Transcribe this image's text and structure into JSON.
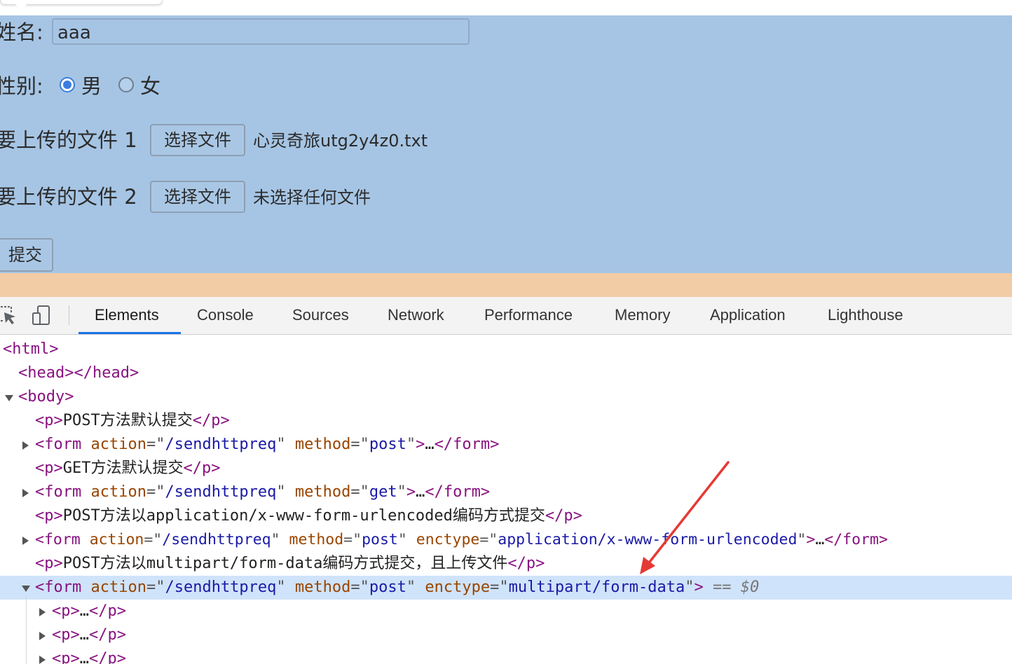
{
  "page": {
    "form": {
      "name_label": "姓名:",
      "name_value": "aaa",
      "gender_label": "性别:",
      "gender_options": [
        {
          "label": "男",
          "checked": true
        },
        {
          "label": "女",
          "checked": false
        }
      ],
      "file1_label": "要上传的文件 1",
      "file1_button": "选择文件",
      "file1_status": "心灵奇旅utg2y4z0.txt",
      "file2_label": "要上传的文件 2",
      "file2_button": "选择文件",
      "file2_status": "未选择任何文件",
      "submit_label": "提交"
    },
    "colors": {
      "content_highlight": "#a6c5e4",
      "margin_highlight": "#f2cca4",
      "selected_row": "#cfe3fa",
      "tab_underline": "#1a73e8",
      "annotation_arrow": "#e53935"
    }
  },
  "devtools": {
    "toolbar_icons": [
      "inspect-element-icon",
      "device-toolbar-icon"
    ],
    "tabs": [
      {
        "label": "Elements",
        "active": true
      },
      {
        "label": "Console",
        "active": false
      },
      {
        "label": "Sources",
        "active": false
      },
      {
        "label": "Network",
        "active": false
      },
      {
        "label": "Performance",
        "active": false
      },
      {
        "label": "Memory",
        "active": false
      },
      {
        "label": "Application",
        "active": false
      },
      {
        "label": "Lighthouse",
        "active": false
      }
    ],
    "dom": {
      "html_tag": "html",
      "head_tag": "head",
      "body_tag": "body",
      "p_tag": "p",
      "form_tag": "form",
      "action_attr": "action",
      "method_attr": "method",
      "enctype_attr": "enctype",
      "action_value": "/sendhttpreq",
      "method_post": "post",
      "method_get": "get",
      "enctype_urlencoded": "application/x-www-form-urlencoded",
      "enctype_multipart": "multipart/form-data",
      "p1_text": "POST方法默认提交",
      "p2_text": "GET方法默认提交",
      "p3_text": "POST方法以application/x-www-form-urlencoded编码方式提交",
      "p4_text": "POST方法以multipart/form-data编码方式提交，且上传文件",
      "ellipsis": "…",
      "selected_marker": "== $0"
    }
  }
}
